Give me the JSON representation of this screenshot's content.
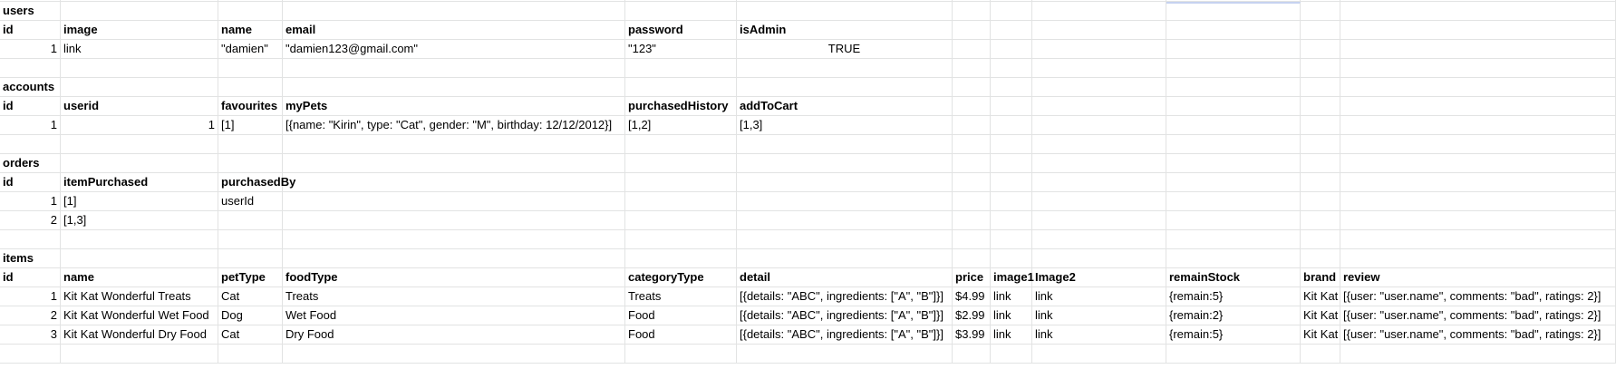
{
  "rows": [
    [
      "users",
      "",
      "",
      "",
      "",
      "",
      "",
      "",
      "",
      "",
      "",
      ""
    ],
    [
      "id",
      "image",
      "name",
      "email",
      "password",
      "isAdmin",
      "",
      "",
      "",
      "",
      "",
      ""
    ],
    [
      "1",
      "link",
      "\"damien\"",
      "\"damien123@gmail.com\"",
      "\"123\"",
      "TRUE",
      "",
      "",
      "",
      "",
      "",
      ""
    ],
    [
      "",
      "",
      "",
      "",
      "",
      "",
      "",
      "",
      "",
      "",
      "",
      ""
    ],
    [
      "accounts",
      "",
      "",
      "",
      "",
      "",
      "",
      "",
      "",
      "",
      "",
      ""
    ],
    [
      "id",
      "userid",
      "favourites",
      "myPets",
      "purchasedHistory",
      "addToCart",
      "",
      "",
      "",
      "",
      "",
      ""
    ],
    [
      "1",
      "1",
      "[1]",
      "[{name: \"Kirin\", type: \"Cat\", gender: \"M\", birthday: 12/12/2012}]",
      "[1,2]",
      "[1,3]",
      "",
      "",
      "",
      "",
      "",
      ""
    ],
    [
      "",
      "",
      "",
      "",
      "",
      "",
      "",
      "",
      "",
      "",
      "",
      ""
    ],
    [
      "orders",
      "",
      "",
      "",
      "",
      "",
      "",
      "",
      "",
      "",
      "",
      ""
    ],
    [
      "id",
      "itemPurchased",
      "purchasedBy",
      "",
      "",
      "",
      "",
      "",
      "",
      "",
      "",
      ""
    ],
    [
      "1",
      "[1]",
      "userId",
      "",
      "",
      "",
      "",
      "",
      "",
      "",
      "",
      ""
    ],
    [
      "2",
      "[1,3]",
      "",
      "",
      "",
      "",
      "",
      "",
      "",
      "",
      "",
      ""
    ],
    [
      "",
      "",
      "",
      "",
      "",
      "",
      "",
      "",
      "",
      "",
      "",
      ""
    ],
    [
      "items",
      "",
      "",
      "",
      "",
      "",
      "",
      "",
      "",
      "",
      "",
      ""
    ],
    [
      "id",
      "name",
      "petType",
      "foodType",
      "categoryType",
      "detail",
      "price",
      "image1",
      "Image2",
      "remainStock",
      "brand",
      "review"
    ],
    [
      "1",
      "Kit Kat Wonderful Treats",
      "Cat",
      "Treats",
      "Treats",
      "[{details: \"ABC\", ingredients: [\"A\", \"B\"]}]",
      "$4.99",
      "link",
      "link",
      "{remain:5}",
      "Kit Kat",
      "[{user: \"user.name\", comments: \"bad\", ratings: 2}]"
    ],
    [
      "2",
      "Kit Kat Wonderful Wet Food",
      "Dog",
      "Wet Food",
      "Food",
      "[{details: \"ABC\", ingredients: [\"A\", \"B\"]}]",
      "$2.99",
      "link",
      "link",
      "{remain:2}",
      "Kit Kat",
      "[{user: \"user.name\", comments: \"bad\", ratings: 2}]"
    ],
    [
      "3",
      "Kit Kat Wonderful Dry Food",
      "Cat",
      "Dry Food",
      "Food",
      "[{details: \"ABC\", ingredients: [\"A\", \"B\"]}]",
      "$3.99",
      "link",
      "link",
      "{remain:5}",
      "Kit Kat",
      "[{user: \"user.name\", comments: \"bad\", ratings: 2}]"
    ],
    [
      "",
      "",
      "",
      "",
      "",
      "",
      "",
      "",
      "",
      "",
      "",
      ""
    ]
  ]
}
